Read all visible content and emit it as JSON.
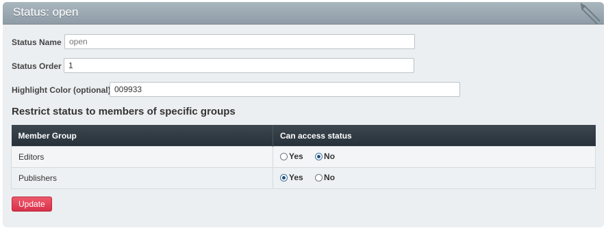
{
  "panel": {
    "title": "Status: open",
    "icon": "pencil-icon"
  },
  "form": {
    "status_name": {
      "label": "Status Name",
      "value": "",
      "placeholder": "open"
    },
    "status_order": {
      "label": "Status Order",
      "value": "1"
    },
    "highlight_color": {
      "label": "Highlight Color (optional)",
      "value": "009933"
    }
  },
  "groups": {
    "heading": "Restrict status to members of specific groups",
    "columns": [
      "Member Group",
      "Can access status"
    ],
    "rows": [
      {
        "name": "Editors",
        "yes_label": "Yes",
        "no_label": "No",
        "selected": "No"
      },
      {
        "name": "Publishers",
        "yes_label": "Yes",
        "no_label": "No",
        "selected": "Yes"
      }
    ]
  },
  "actions": {
    "update_label": "Update"
  },
  "colors": {
    "header": "#99a6ae",
    "table_header": "#2f3a43",
    "button": "#dc3a50",
    "panel_bg": "#eceff1"
  }
}
